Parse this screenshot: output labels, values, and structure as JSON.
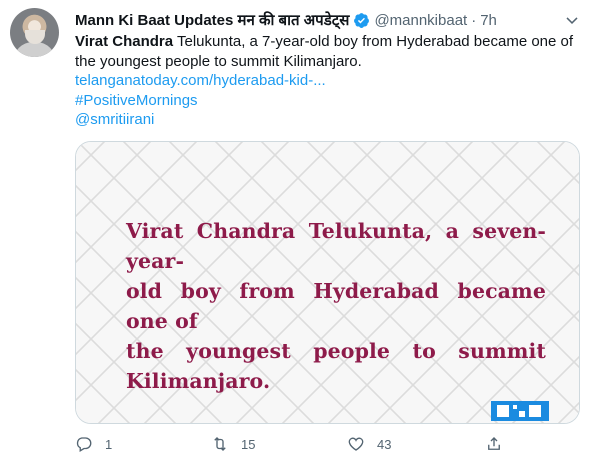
{
  "author": {
    "name": "Mann Ki Baat Updates मन की बात अपडेट्स",
    "handle": "@mannkibaat",
    "separator": "·",
    "time": "7h"
  },
  "tweet": {
    "mention_bold": "Virat Chandra",
    "text": " Telukunta, a 7-year-old boy from Hyderabad became one of the youngest people to summit Kilimanjaro.",
    "link": "telanganatoday.com/hyderabad-kid-...",
    "hashtag": "#PositiveMornings",
    "mention": "@smritiirani"
  },
  "media": {
    "quote_line1": "Virat Chandra Telukunta, a seven-year-",
    "quote_line2": "old boy from Hyderabad became one of",
    "quote_line3": "the youngest people to summit",
    "quote_line4": "Kilimanjaro.",
    "quote_color": "#8e1b4a"
  },
  "actions": {
    "reply_count": "1",
    "retweet_count": "15",
    "like_count": "43",
    "icons": [
      "reply-icon",
      "retweet-icon",
      "like-icon",
      "share-icon"
    ]
  },
  "colors": {
    "link": "#1d9bf0",
    "secondary": "#536471",
    "verified": "#1d9bf0"
  }
}
